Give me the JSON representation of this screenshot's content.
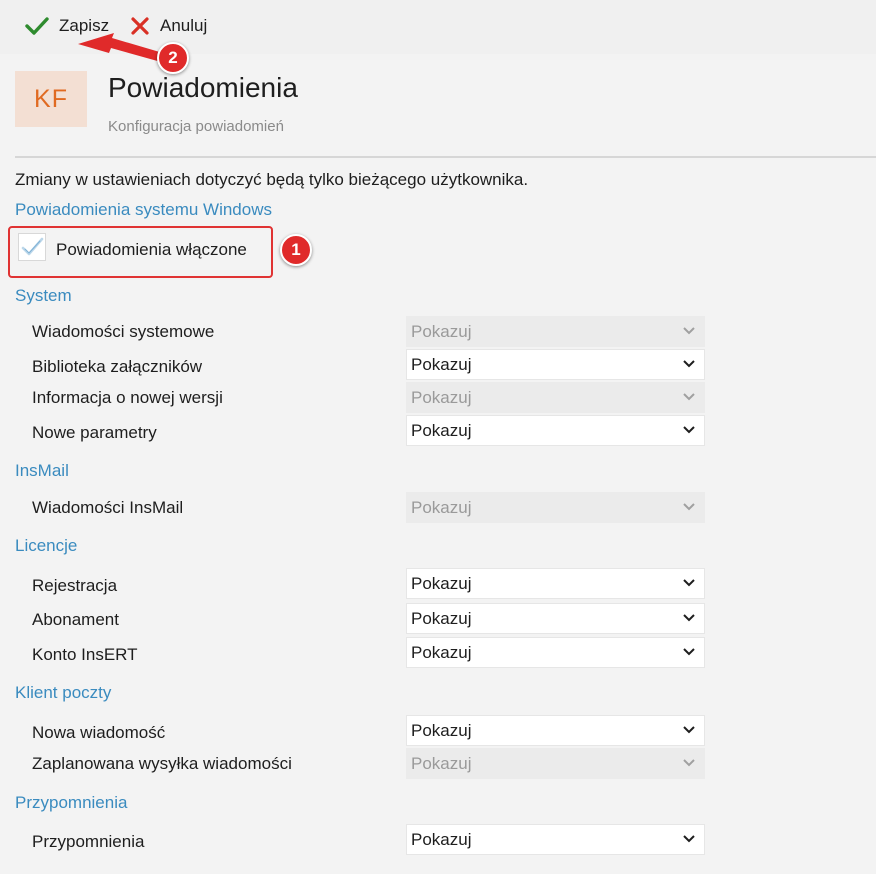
{
  "toolbar": {
    "save_label": "Zapisz",
    "cancel_label": "Anuluj"
  },
  "header": {
    "badge_text": "KF",
    "title": "Powiadomienia",
    "subtitle": "Konfiguracja powiadomień"
  },
  "info": "Zmiany w ustawieniach dotyczyć będą tylko bieżącego użytkownika.",
  "windows_notifications": {
    "heading": "Powiadomienia systemu Windows",
    "checkbox_label": "Powiadomienia włączone",
    "checked": true
  },
  "annotations": {
    "marker_1": "1",
    "marker_2": "2"
  },
  "sections": {
    "system": {
      "heading": "System",
      "rows": [
        {
          "label": "Wiadomości systemowe",
          "value": "Pokazuj",
          "enabled": false
        },
        {
          "label": "Biblioteka załączników",
          "value": "Pokazuj",
          "enabled": true
        },
        {
          "label": "Informacja o nowej wersji",
          "value": "Pokazuj",
          "enabled": false
        },
        {
          "label": "Nowe parametry",
          "value": "Pokazuj",
          "enabled": true
        }
      ]
    },
    "insmail": {
      "heading": "InsMail",
      "rows": [
        {
          "label": "Wiadomości InsMail",
          "value": "Pokazuj",
          "enabled": false
        }
      ]
    },
    "licencje": {
      "heading": "Licencje",
      "rows": [
        {
          "label": "Rejestracja",
          "value": "Pokazuj",
          "enabled": true
        },
        {
          "label": "Abonament",
          "value": "Pokazuj",
          "enabled": true
        },
        {
          "label": "Konto InsERT",
          "value": "Pokazuj",
          "enabled": true
        }
      ]
    },
    "klient": {
      "heading": "Klient poczty",
      "rows": [
        {
          "label": "Nowa wiadomość",
          "value": "Pokazuj",
          "enabled": true
        },
        {
          "label": "Zaplanowana wysyłka wiadomości",
          "value": "Pokazuj",
          "enabled": false
        }
      ]
    },
    "przypomnienia": {
      "heading": "Przypomnienia",
      "rows": [
        {
          "label": "Przypomnienia",
          "value": "Pokazuj",
          "enabled": true
        }
      ]
    }
  },
  "colors": {
    "accent": "#3a8bbf",
    "save_check": "#2e8b2e",
    "cancel_x": "#d93025",
    "annotation_red": "#e02a2a",
    "brand_tile_bg": "#f3dfd3",
    "brand_tile_text": "#e06a21"
  }
}
